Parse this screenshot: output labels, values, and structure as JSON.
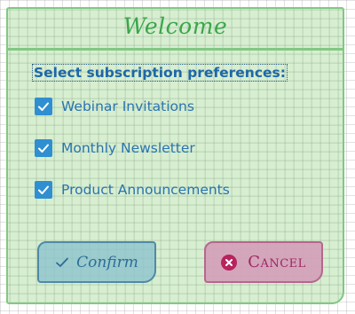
{
  "dialog": {
    "title": "Welcome",
    "prompt": "Select subscription preferences:",
    "options": [
      {
        "label": "Webinar Invitations",
        "checked": true
      },
      {
        "label": "Monthly Newsletter",
        "checked": true
      },
      {
        "label": "Product Announcements",
        "checked": true
      }
    ],
    "confirm_label": "Confirm",
    "cancel_label": "Cancel"
  },
  "colors": {
    "panel": "#cfe9c8",
    "title": "#3aa64a",
    "checkbox": "#2f8fd0",
    "text": "#2a74ae",
    "confirm": "#8cc3cd",
    "cancel": "#d4a0b9",
    "cancel_icon": "#b8235e"
  },
  "icons": {
    "checkbox": "check-icon",
    "confirm": "check-icon",
    "cancel": "close-circle-icon"
  }
}
